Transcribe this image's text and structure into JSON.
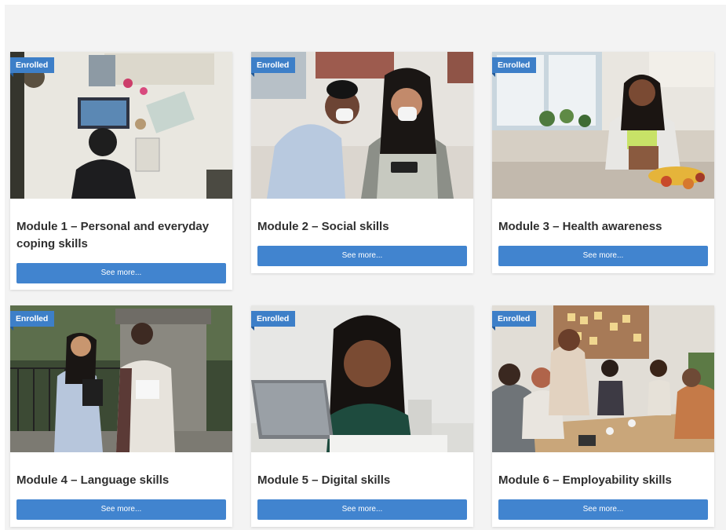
{
  "colors": {
    "background": "#f3f3f3",
    "card": "#ffffff",
    "badge": "#3d7fc8",
    "button": "#4184cf",
    "title_text": "#2f2f2f"
  },
  "modules": [
    {
      "badge": "Enrolled",
      "title": "Module 1 – Personal and everyday coping skills",
      "button": "See more...",
      "image": "person-drawing-at-art-desk-photo"
    },
    {
      "badge": "Enrolled",
      "title": "Module 2 – Social skills",
      "button": "See more...",
      "image": "two-students-with-masks-tablet-photo"
    },
    {
      "badge": "Enrolled",
      "title": "Module 3 – Health awareness",
      "button": "See more...",
      "image": "woman-cutting-fruit-kitchen-photo"
    },
    {
      "badge": "Enrolled",
      "title": "Module 4 – Language skills",
      "button": "See more...",
      "image": "two-students-talking-outdoors-photo"
    },
    {
      "badge": "Enrolled",
      "title": "Module 5 – Digital skills",
      "button": "See more...",
      "image": "smiling-woman-laptop-photo"
    },
    {
      "badge": "Enrolled",
      "title": "Module 6 – Employability skills",
      "button": "See more...",
      "image": "team-meeting-handshake-photo"
    }
  ]
}
